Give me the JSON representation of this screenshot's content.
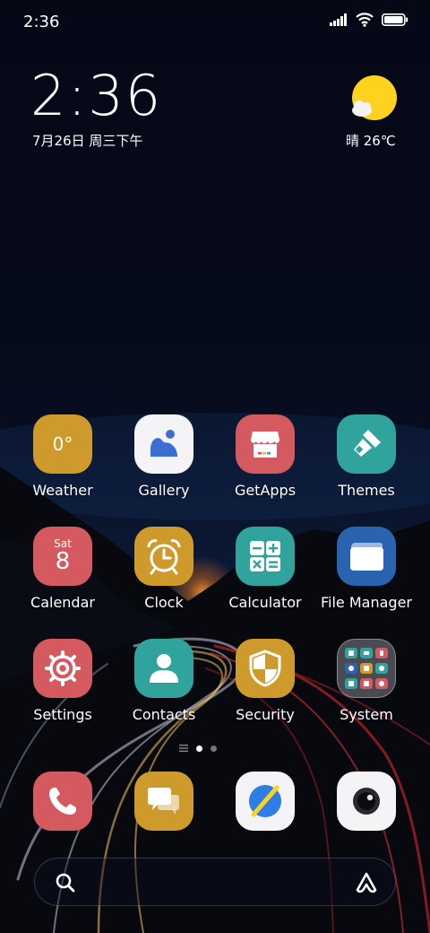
{
  "status_bar": {
    "time": "2:36",
    "icons": [
      "signal-icon",
      "wifi-icon",
      "battery-icon"
    ]
  },
  "clock_widget": {
    "time": "2:36",
    "date": "7月26日 周三下午",
    "weather": "晴 26℃",
    "weather_icon": "sun-cloud-icon"
  },
  "apps": [
    {
      "label": "Weather",
      "icon": "weather-icon",
      "icon_text": "0°",
      "color": "#cf9a2c"
    },
    {
      "label": "Gallery",
      "icon": "gallery-icon",
      "color": "#f4f4f6"
    },
    {
      "label": "GetApps",
      "icon": "store-icon",
      "color": "#d45a5f"
    },
    {
      "label": "Themes",
      "icon": "brush-icon",
      "color": "#2fa39c"
    },
    {
      "label": "Calendar",
      "icon": "calendar-icon",
      "icon_day": "Sat",
      "icon_date": "8",
      "color": "#d45a5f"
    },
    {
      "label": "Clock",
      "icon": "alarm-clock-icon",
      "color": "#cf9a2c"
    },
    {
      "label": "Calculator",
      "icon": "calculator-icon",
      "color": "#2fa39c"
    },
    {
      "label": "File Manager",
      "icon": "folder-icon",
      "color": "#2a64b0"
    },
    {
      "label": "Settings",
      "icon": "gear-icon",
      "color": "#d45a5f"
    },
    {
      "label": "Contacts",
      "icon": "person-icon",
      "color": "#2fa39c"
    },
    {
      "label": "Security",
      "icon": "shield-icon",
      "color": "#cf9a2c"
    },
    {
      "label": "System",
      "icon": "folder-group-icon",
      "color": "#bcbcc4"
    }
  ],
  "page_indicator": {
    "pages": 2,
    "current": 1
  },
  "dock": [
    {
      "icon": "phone-icon",
      "color": "#d45a5f"
    },
    {
      "icon": "messages-icon",
      "color": "#cf9a2c"
    },
    {
      "icon": "browser-icon",
      "color": "#f4f4f6"
    },
    {
      "icon": "camera-icon",
      "color": "#f4f4f6"
    }
  ],
  "search_bar": {
    "left_icon": "search-icon",
    "right_icon": "assistant-icon"
  }
}
